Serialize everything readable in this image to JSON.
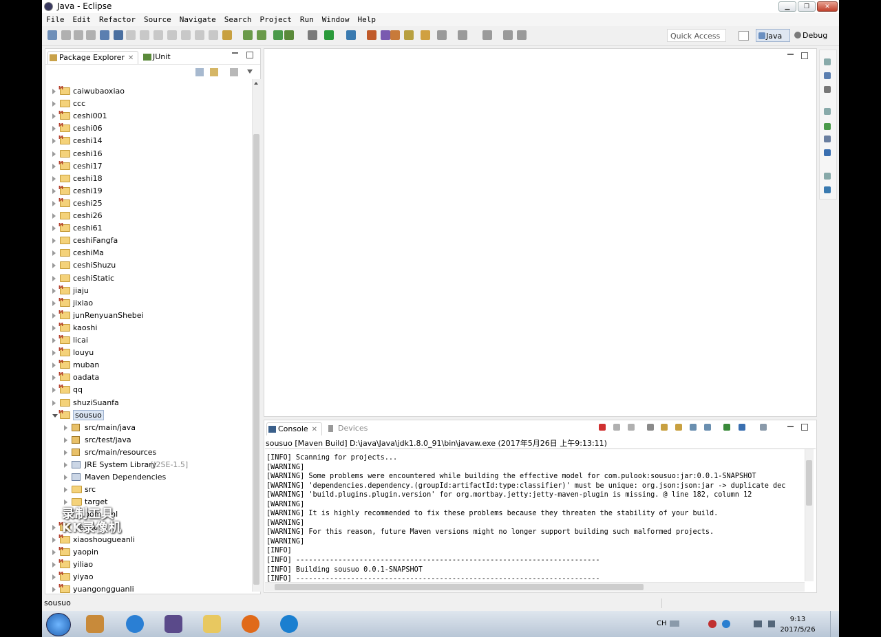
{
  "window": {
    "title": "Java - Eclipse"
  },
  "menu": [
    "File",
    "Edit",
    "Refactor",
    "Source",
    "Navigate",
    "Search",
    "Project",
    "Run",
    "Window",
    "Help"
  ],
  "toolbar": {
    "quick_access": "Quick Access"
  },
  "perspectives": {
    "java": "Java",
    "debug": "Debug"
  },
  "package_explorer": {
    "tab_label": "Package Explorer",
    "junit_label": "JUnit",
    "projects": [
      {
        "name": "caiwubaoxiao",
        "maven": true
      },
      {
        "name": "ccc",
        "maven": false
      },
      {
        "name": "ceshi001",
        "maven": true
      },
      {
        "name": "ceshi06",
        "maven": true
      },
      {
        "name": "ceshi14",
        "maven": true
      },
      {
        "name": "ceshi16",
        "maven": false
      },
      {
        "name": "ceshi17",
        "maven": true
      },
      {
        "name": "ceshi18",
        "maven": false
      },
      {
        "name": "ceshi19",
        "maven": true
      },
      {
        "name": "ceshi25",
        "maven": true
      },
      {
        "name": "ceshi26",
        "maven": false
      },
      {
        "name": "ceshi61",
        "maven": true
      },
      {
        "name": "ceshiFangfa",
        "maven": false
      },
      {
        "name": "ceshiMa",
        "maven": false
      },
      {
        "name": "ceshiShuzu",
        "maven": false
      },
      {
        "name": "ceshiStatic",
        "maven": false
      },
      {
        "name": "jiaju",
        "maven": true
      },
      {
        "name": "jixiao",
        "maven": true
      },
      {
        "name": "junRenyuanShebei",
        "maven": true
      },
      {
        "name": "kaoshi",
        "maven": true
      },
      {
        "name": "licai",
        "maven": true
      },
      {
        "name": "louyu",
        "maven": true
      },
      {
        "name": "muban",
        "maven": true
      },
      {
        "name": "oadata",
        "maven": true
      },
      {
        "name": "qq",
        "maven": true
      },
      {
        "name": "shuziSuanfa",
        "maven": false
      },
      {
        "name": "sousuo",
        "maven": true
      }
    ],
    "sousuo_children": [
      {
        "name": "src/main/java",
        "kind": "pkg",
        "deco": ""
      },
      {
        "name": "src/test/java",
        "kind": "pkg",
        "deco": ""
      },
      {
        "name": "src/main/resources",
        "kind": "pkg",
        "deco": ""
      },
      {
        "name": "JRE System Library",
        "kind": "jar",
        "deco": "[J2SE-1.5]"
      },
      {
        "name": "Maven Dependencies",
        "kind": "jar",
        "deco": ""
      },
      {
        "name": "src",
        "kind": "folder",
        "deco": ""
      },
      {
        "name": "target",
        "kind": "folder",
        "deco": ""
      },
      {
        "name": "pom.xml",
        "kind": "file",
        "deco": ""
      }
    ],
    "after_projects": [
      {
        "name": "wendu",
        "maven": true
      },
      {
        "name": "xiaoshougueanli",
        "maven": true
      },
      {
        "name": "yaopin",
        "maven": true
      },
      {
        "name": "yiliao",
        "maven": true
      },
      {
        "name": "yiyao",
        "maven": true
      },
      {
        "name": "yuangongguanli",
        "maven": true
      }
    ]
  },
  "console": {
    "tab_label": "Console",
    "devices_label": "Devices",
    "launch": "sousuo [Maven Build] D:\\java\\Java\\jdk1.8.0_91\\bin\\javaw.exe (2017年5月26日 上午9:13:11)",
    "lines": [
      "[INFO] Scanning for projects...",
      "[WARNING]",
      "[WARNING] Some problems were encountered while building the effective model for com.pulook:sousuo:jar:0.0.1-SNAPSHOT",
      "[WARNING] 'dependencies.dependency.(groupId:artifactId:type:classifier)' must be unique: org.json:json:jar -> duplicate dec",
      "[WARNING] 'build.plugins.plugin.version' for org.mortbay.jetty:jetty-maven-plugin is missing. @ line 182, column 12",
      "[WARNING]",
      "[WARNING] It is highly recommended to fix these problems because they threaten the stability of your build.",
      "[WARNING]",
      "[WARNING] For this reason, future Maven versions might no longer support building such malformed projects.",
      "[WARNING]",
      "[INFO]",
      "[INFO] ------------------------------------------------------------------------",
      "[INFO] Building sousuo 0.0.1-SNAPSHOT",
      "[INFO] ------------------------------------------------------------------------"
    ]
  },
  "status": {
    "selected": "sousuo"
  },
  "watermark": {
    "line1": "录制工具",
    "line2": "KK录像机"
  },
  "tray": {
    "lang": "CH",
    "time": "9:13",
    "date": "2017/5/26"
  }
}
